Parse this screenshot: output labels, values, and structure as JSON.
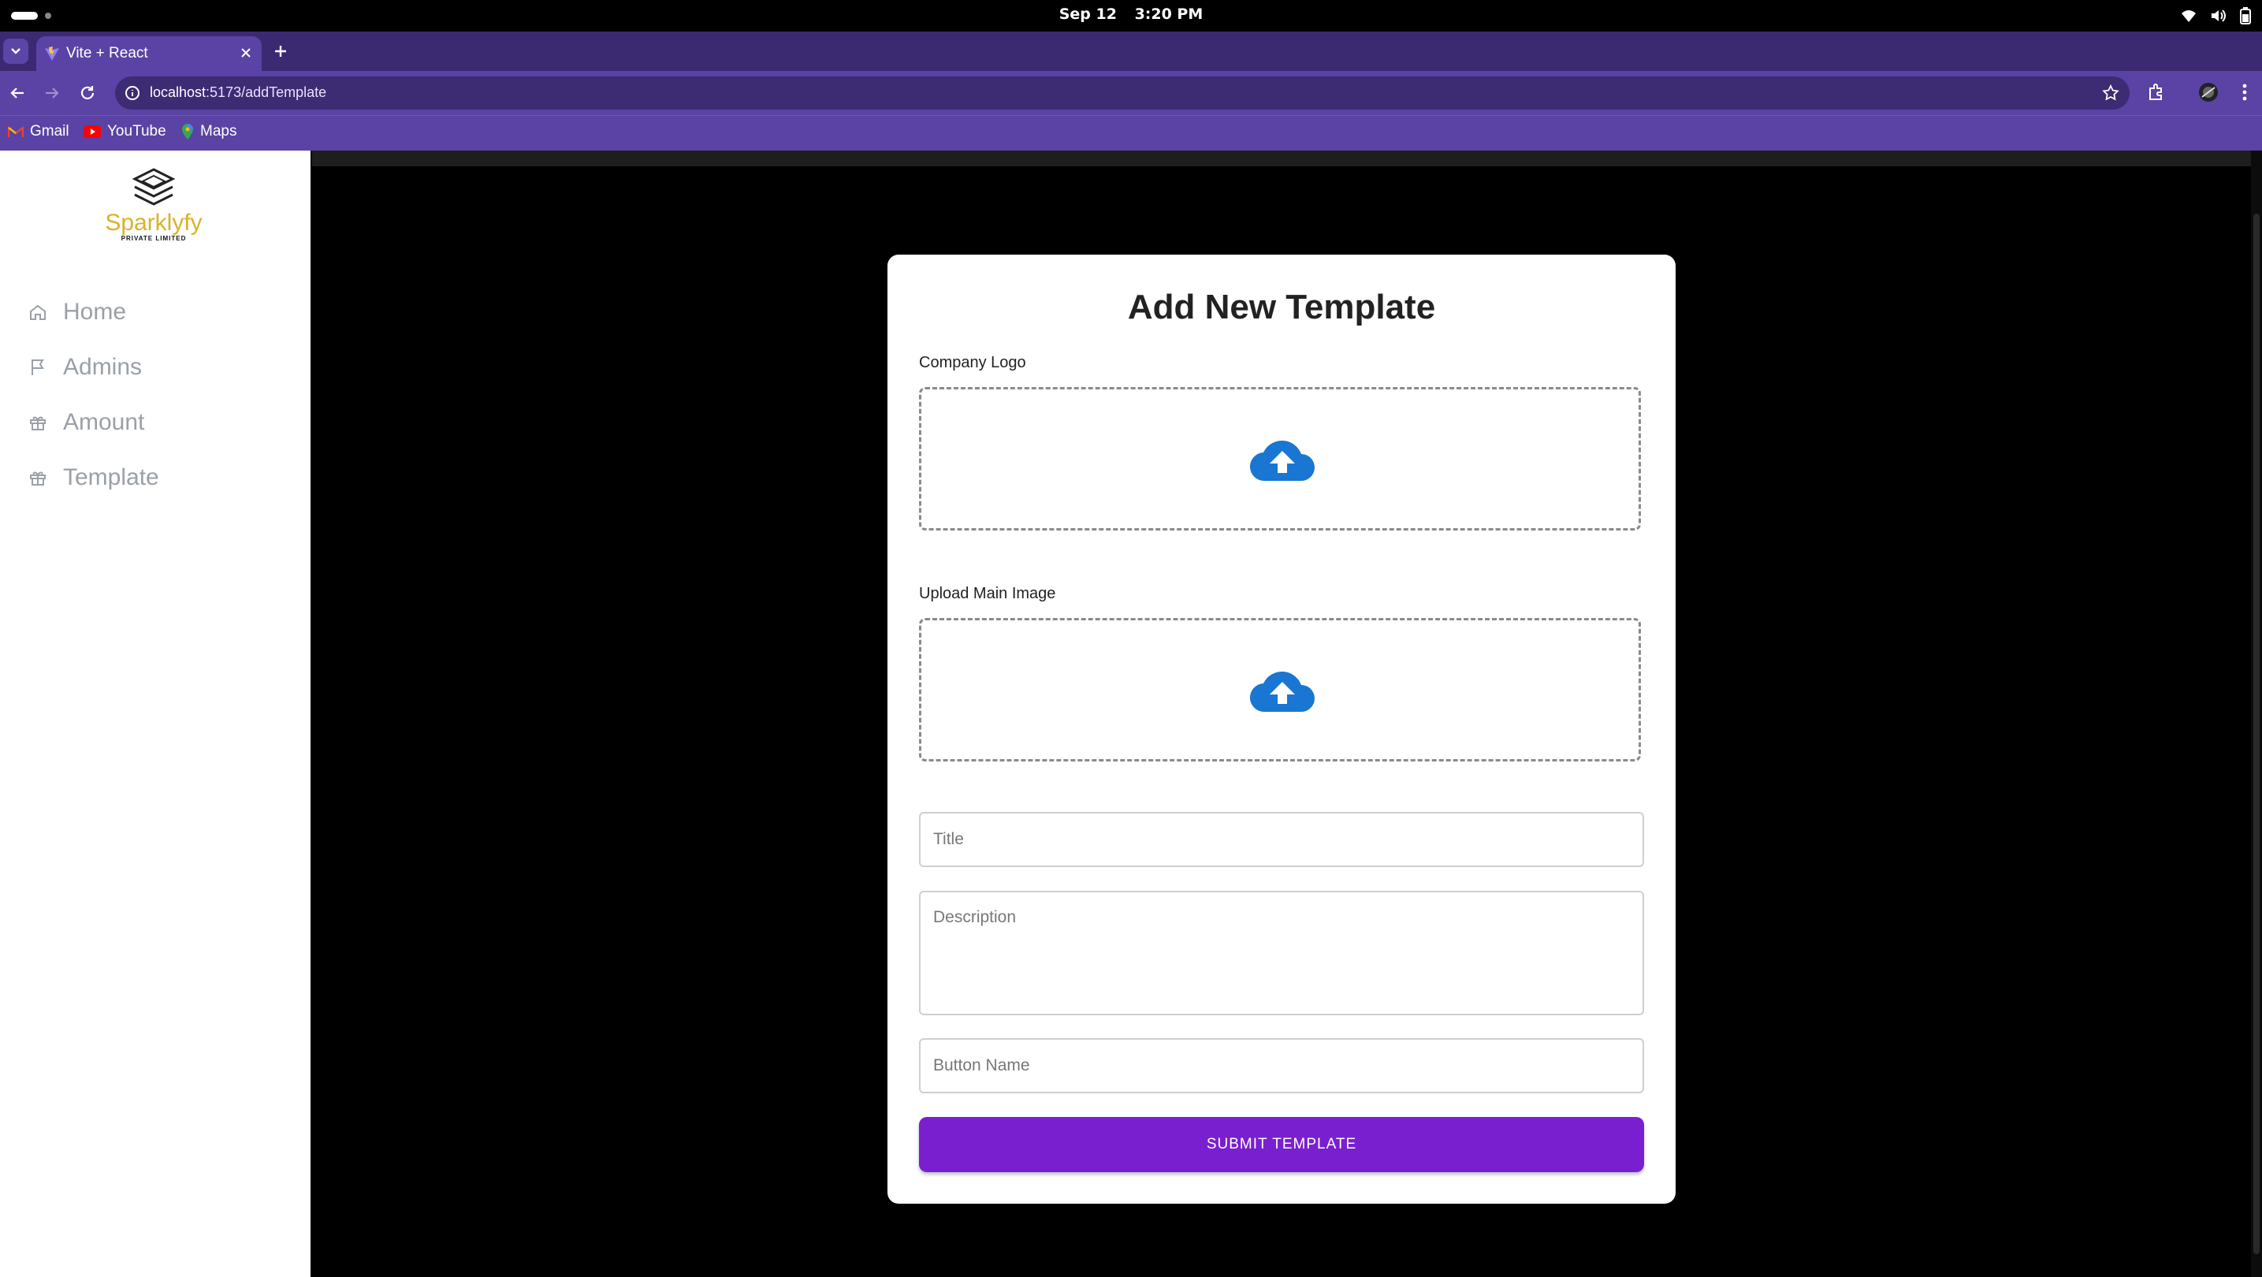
{
  "os": {
    "date": "Sep 12",
    "time": "3:20 PM"
  },
  "browser": {
    "tab_title": "Vite + React",
    "url_host": "localhost",
    "url_path": ":5173/addTemplate",
    "bookmarks": [
      "Gmail",
      "YouTube",
      "Maps"
    ]
  },
  "sidebar": {
    "logo_name": "Sparklyfy",
    "logo_sub": "PRIVATE LIMITED",
    "items": [
      {
        "label": "Home",
        "icon": "home-icon"
      },
      {
        "label": "Admins",
        "icon": "flag-icon"
      },
      {
        "label": "Amount",
        "icon": "gift-icon"
      },
      {
        "label": "Template",
        "icon": "gift-icon"
      }
    ]
  },
  "form": {
    "title": "Add New Template",
    "logo_label": "Company Logo",
    "main_image_label": "Upload Main Image",
    "title_placeholder": "Title",
    "description_placeholder": "Description",
    "button_name_placeholder": "Button Name",
    "submit_label": "SUBMIT TEMPLATE"
  },
  "colors": {
    "accent": "#7a1fd0",
    "upload_icon": "#1976d2",
    "chrome": "#5a43a4",
    "logo_gold": "#d9b229"
  }
}
